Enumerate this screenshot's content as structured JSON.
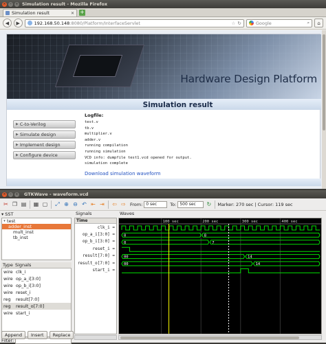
{
  "firefox": {
    "window_title": "Simulation result - Mozilla Firefox",
    "tab_title": "Simulation result",
    "url_host": "192.168.50.148",
    "url_path": ":8080/Platform/InterfaceServlet",
    "search_placeholder": "Google",
    "banner_title": "Hardware Design Platform",
    "page_heading": "Simulation result",
    "menu": [
      {
        "label": "C-to-Verilog"
      },
      {
        "label": "Simulate design"
      },
      {
        "label": "Implement design"
      },
      {
        "label": "Configure device"
      }
    ],
    "log_label": "Logfile:",
    "log_lines": [
      "test.v",
      "tb.v",
      "multiplier.v",
      "adder.v",
      "running compilation",
      "running simulation",
      "VCD info: dumpfile test1.vcd opened for output.",
      "simulation complete"
    ],
    "download_link": "Download simulation waveform"
  },
  "gtkwave": {
    "window_title": "GTKWave - waveform.vcd",
    "from_label": "From:",
    "from_value": "0 sec",
    "to_label": "To:",
    "to_value": "500 sec",
    "marker_text": "Marker: 270 sec",
    "cursor_text": "Cursor: 119 sec",
    "sst_label": "SST",
    "tree": [
      {
        "label": "test",
        "indent": 0,
        "expander": "▾"
      },
      {
        "label": "adder_inst",
        "indent": 1,
        "expander": "",
        "selected": true
      },
      {
        "label": "mult_inst",
        "indent": 1,
        "expander": ""
      },
      {
        "label": "tb_inst",
        "indent": 1,
        "expander": ""
      }
    ],
    "sig_header": {
      "type": "Type",
      "name": "Signals"
    },
    "sig_list": [
      {
        "type": "wire",
        "name": "clk_i"
      },
      {
        "type": "wire",
        "name": "op_a_i[3:0]"
      },
      {
        "type": "wire",
        "name": "op_b_i[3:0]"
      },
      {
        "type": "wire",
        "name": "reset_i"
      },
      {
        "type": "reg",
        "name": "result[7:0]"
      },
      {
        "type": "reg",
        "name": "result_o[7:0]",
        "selected": true
      },
      {
        "type": "wire",
        "name": "start_i"
      }
    ],
    "filter_label": "Filter:",
    "buttons": {
      "append": "Append",
      "insert": "Insert",
      "replace": "Replace"
    },
    "signals_label": "Signals",
    "time_header": "Time",
    "signal_names": [
      "clk_i =",
      "op_a_i[3:0] =",
      "op_b_i[3:0] =",
      "reset_i =",
      "result[7:0] =",
      "result_o[7:0] =",
      "start_i ="
    ],
    "waves_label": "Waves",
    "ruler_labels": [
      "100 sec",
      "200 sec",
      "300 sec",
      "400 sec"
    ],
    "value_labels": {
      "op_a_0": "0",
      "op_a_1": "8",
      "op_b_0": "0",
      "op_b_1": "7",
      "result_0": "00",
      "result_1": "14",
      "result_o_0": "00",
      "result_o_1": "14"
    },
    "colors": {
      "wave": "#00e000",
      "marker": "#ffffff",
      "cursor": "#ffff00",
      "background": "#000000"
    }
  }
}
